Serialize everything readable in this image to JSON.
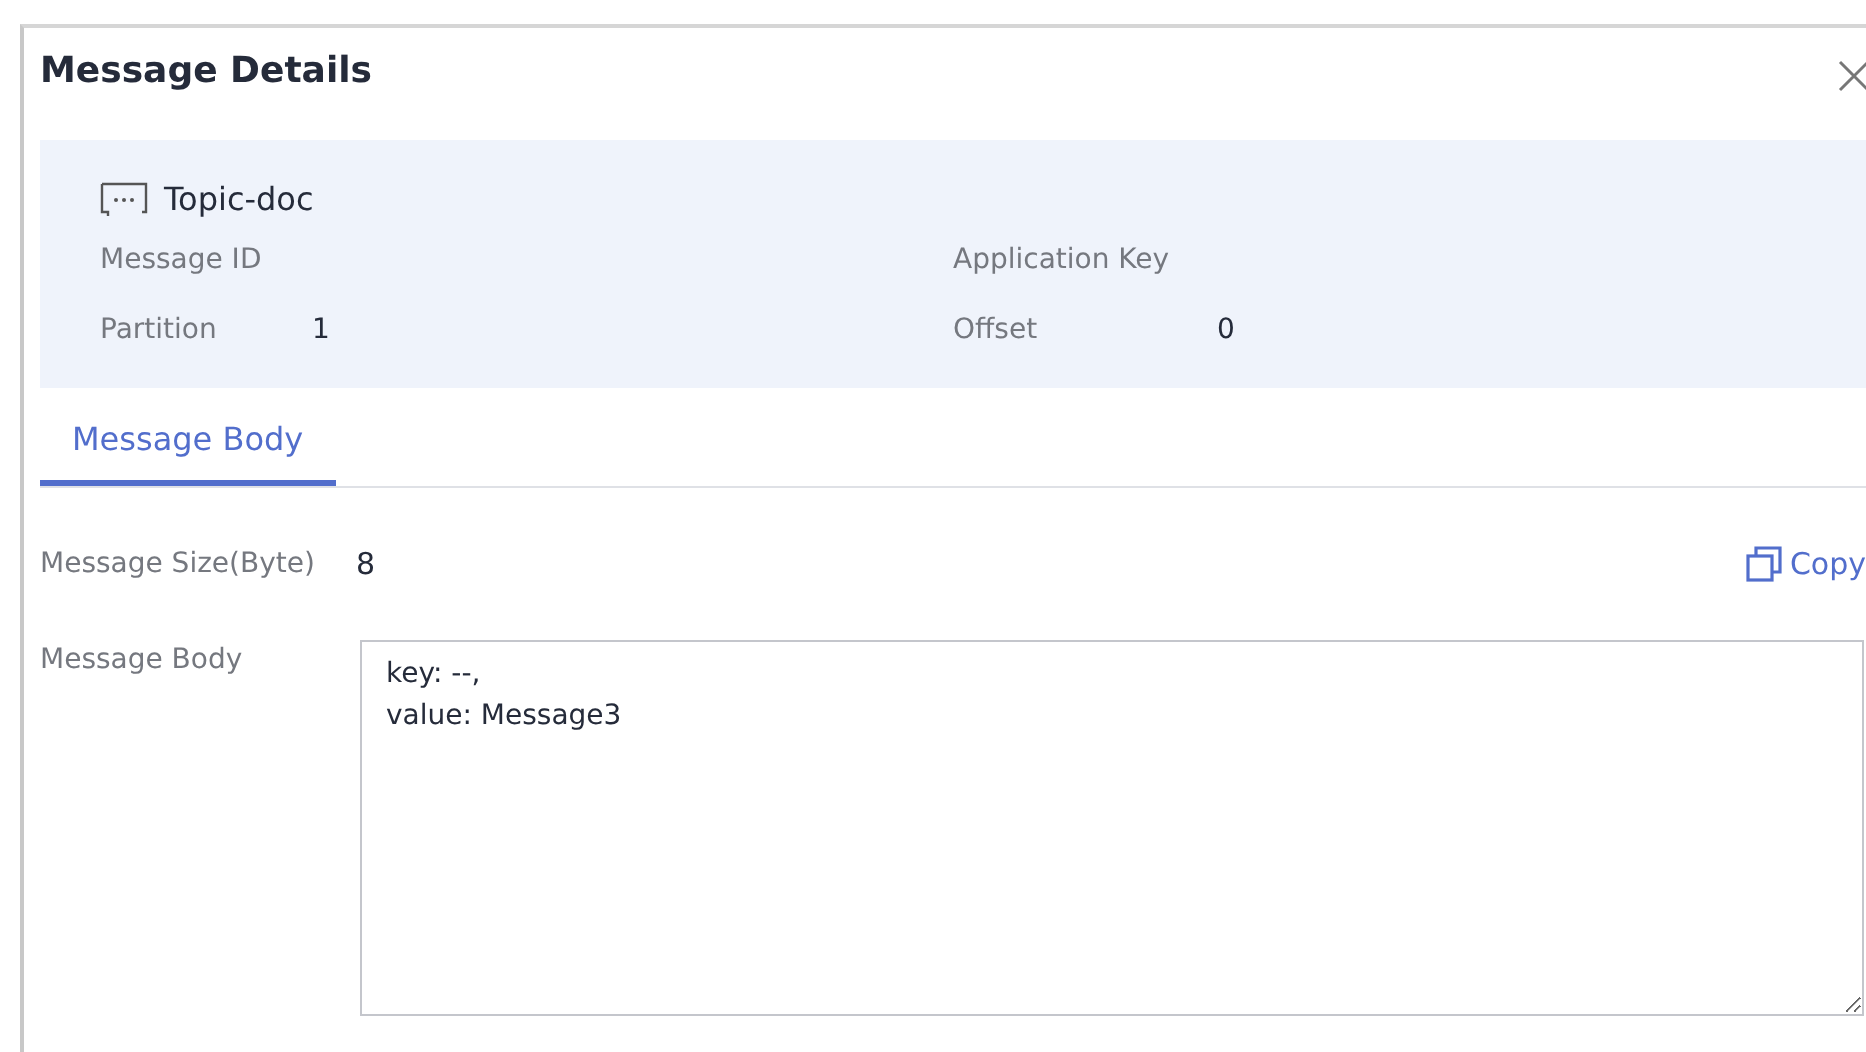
{
  "dialog": {
    "title": "Message Details"
  },
  "topic": {
    "name": "Topic-doc"
  },
  "fields": [
    {
      "label": "Message ID"
    },
    {
      "label": "Application Key"
    },
    {
      "label": "Partition",
      "value": "1"
    },
    {
      "label": "Offset",
      "value": "0"
    }
  ],
  "tabs": [
    {
      "label": "Message Body",
      "selected": true
    }
  ],
  "size": {
    "label": "Message Size(Byte)",
    "value": "8",
    "action": "Copy"
  },
  "body": {
    "label": "Message Body",
    "value": "key: --,\nvalue: Message3"
  }
}
